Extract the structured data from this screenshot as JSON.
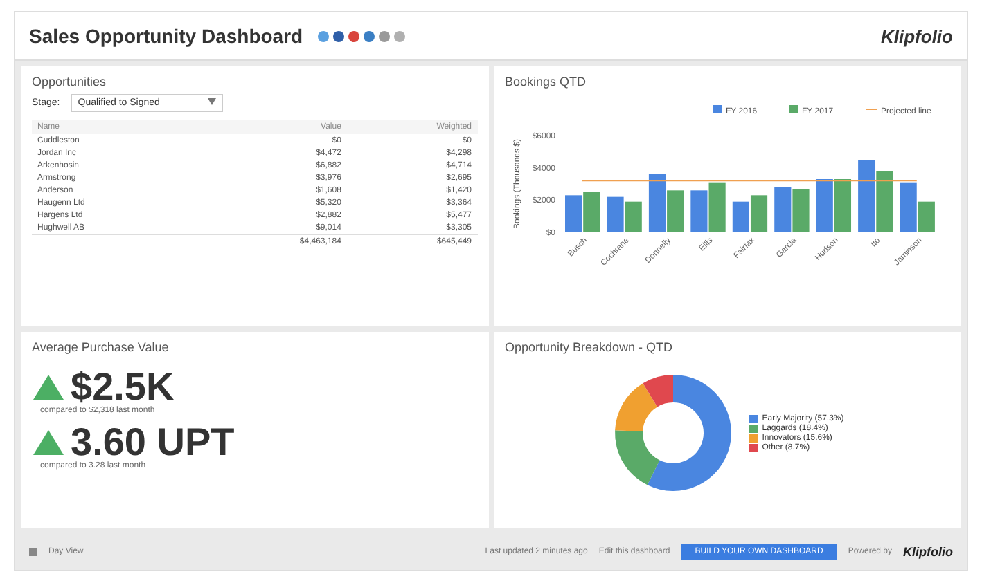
{
  "header": {
    "title": "Sales Opportunity Dashboard",
    "share_icons": [
      {
        "color": "#5aa0e0"
      },
      {
        "color": "#2f5fa8"
      },
      {
        "color": "#d9453d"
      },
      {
        "color": "#3a7fc4"
      },
      {
        "color": "#9a9a9a"
      },
      {
        "color": "#b0b0b0"
      }
    ],
    "logo": "Klipfolio"
  },
  "opportunities": {
    "title": "Opportunities",
    "filter_label": "Stage:",
    "filter_value": "Qualified to Signed",
    "columns": [
      "Name",
      "Value",
      "Weighted"
    ],
    "rows": [
      [
        "Cuddleston",
        "$0",
        "$0"
      ],
      [
        "Jordan Inc",
        "$4,472",
        "$4,298"
      ],
      [
        "Arkenhosin",
        "$6,882",
        "$4,714"
      ],
      [
        "Armstrong",
        "$3,976",
        "$2,695"
      ],
      [
        "Anderson",
        "$1,608",
        "$1,420"
      ],
      [
        "Haugenn Ltd",
        "$5,320",
        "$3,364"
      ],
      [
        "Hargens Ltd",
        "$2,882",
        "$5,477"
      ],
      [
        "Hughwell AB",
        "$9,014",
        "$3,305"
      ]
    ],
    "totals": [
      "$4,463,184",
      "$645,449"
    ]
  },
  "bookings": {
    "title": "Bookings QTD",
    "chart_data": {
      "type": "bar",
      "ylabel": "Bookings (Thousands $)",
      "categories": [
        "Busch",
        "Cochrane",
        "Donnelly",
        "Ellis",
        "Fairfax",
        "Garcia",
        "Hudson",
        "Ito",
        "Jamieson"
      ],
      "series": [
        {
          "name": "FY 2016",
          "color": "#4a86e0",
          "values": [
            2300,
            2200,
            3600,
            2600,
            1900,
            2800,
            3300,
            4500,
            3100
          ]
        },
        {
          "name": "FY 2017",
          "color": "#5aaa68",
          "values": [
            2500,
            1900,
            2600,
            3100,
            2300,
            2700,
            3300,
            3800,
            1900
          ]
        },
        {
          "name": "Projected line",
          "color": "#f0a050",
          "type": "line",
          "values": [
            3200,
            3200,
            3200,
            3200,
            3200,
            3200,
            3200,
            3200,
            3200
          ]
        }
      ],
      "legend": "top",
      "ylim": [
        0,
        6000
      ],
      "yticks": [
        {
          "value": 0,
          "label": "$0"
        },
        {
          "value": 2000,
          "label": "$2000"
        },
        {
          "value": 4000,
          "label": "$4000"
        },
        {
          "value": 6000,
          "label": "$6000"
        }
      ]
    }
  },
  "purchase": {
    "title": "Average Purchase Value",
    "metrics": [
      {
        "value": "$2.5K",
        "kind": "up",
        "caption": "compared to $2,318 last month"
      },
      {
        "value": "3.60 UPT",
        "kind": "up",
        "caption": "compared to 3.28 last month"
      }
    ]
  },
  "breakdown": {
    "title": "Opportunity Breakdown - QTD",
    "chart_data": {
      "type": "donut",
      "categories": [
        "Early Majority (57.3%)",
        "Laggards (18.4%)",
        "Innovators (15.6%)",
        "Other (8.7%)"
      ],
      "values": [
        57.3,
        18.4,
        15.6,
        8.7
      ],
      "legend": "right",
      "colors": [
        "#4a86e0",
        "#5aaa68",
        "#f0a030",
        "#e0484e"
      ]
    }
  },
  "footer": {
    "view_label": "Day View",
    "updated": "Last updated 2 minutes ago",
    "edit_link": "Edit this dashboard",
    "cta": "BUILD YOUR OWN DASHBOARD",
    "powered": "Powered by",
    "logo": "Klipfolio"
  }
}
